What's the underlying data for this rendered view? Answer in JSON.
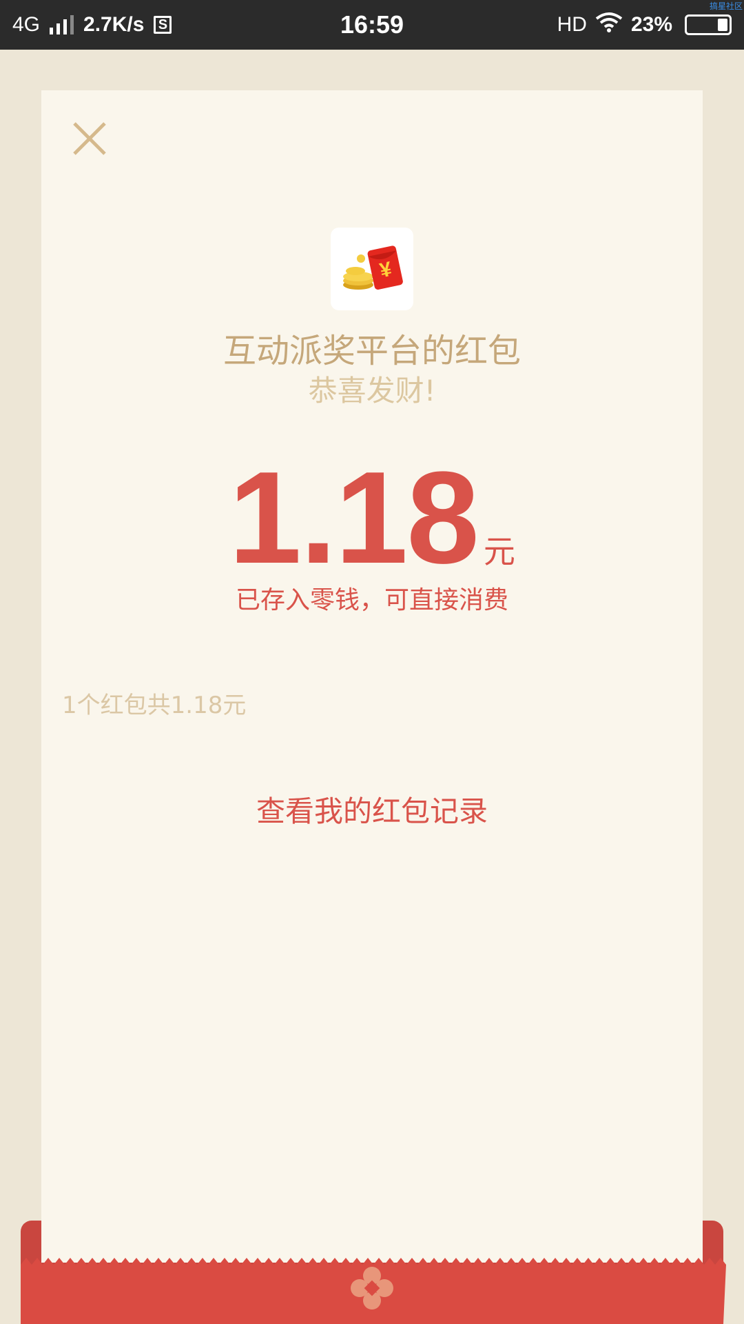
{
  "status_bar": {
    "network": "4G",
    "speed": "2.7K/s",
    "s_icon_letter": "S",
    "time": "16:59",
    "hd": "HD",
    "battery_percent": "23%",
    "battery_level": 0.23,
    "watermark": "搞星社区"
  },
  "envelope": {
    "sender": "互动派奖平台的红包",
    "greeting": "恭喜发财!",
    "amount": "1.18",
    "unit": "元",
    "deposit_note": "已存入零钱，可直接消费",
    "summary": "1个红包共1.18元",
    "records_link": "查看我的红包记录"
  },
  "colors": {
    "background": "#ede6d6",
    "card": "#faf6ec",
    "gold_text": "#c5a77a",
    "red": "#d9534a",
    "status_bar": "#2b2b2b"
  },
  "icons": {
    "close": "close-icon",
    "logo": "red-envelope-coins-icon",
    "footer": "flower-emblem-icon"
  }
}
